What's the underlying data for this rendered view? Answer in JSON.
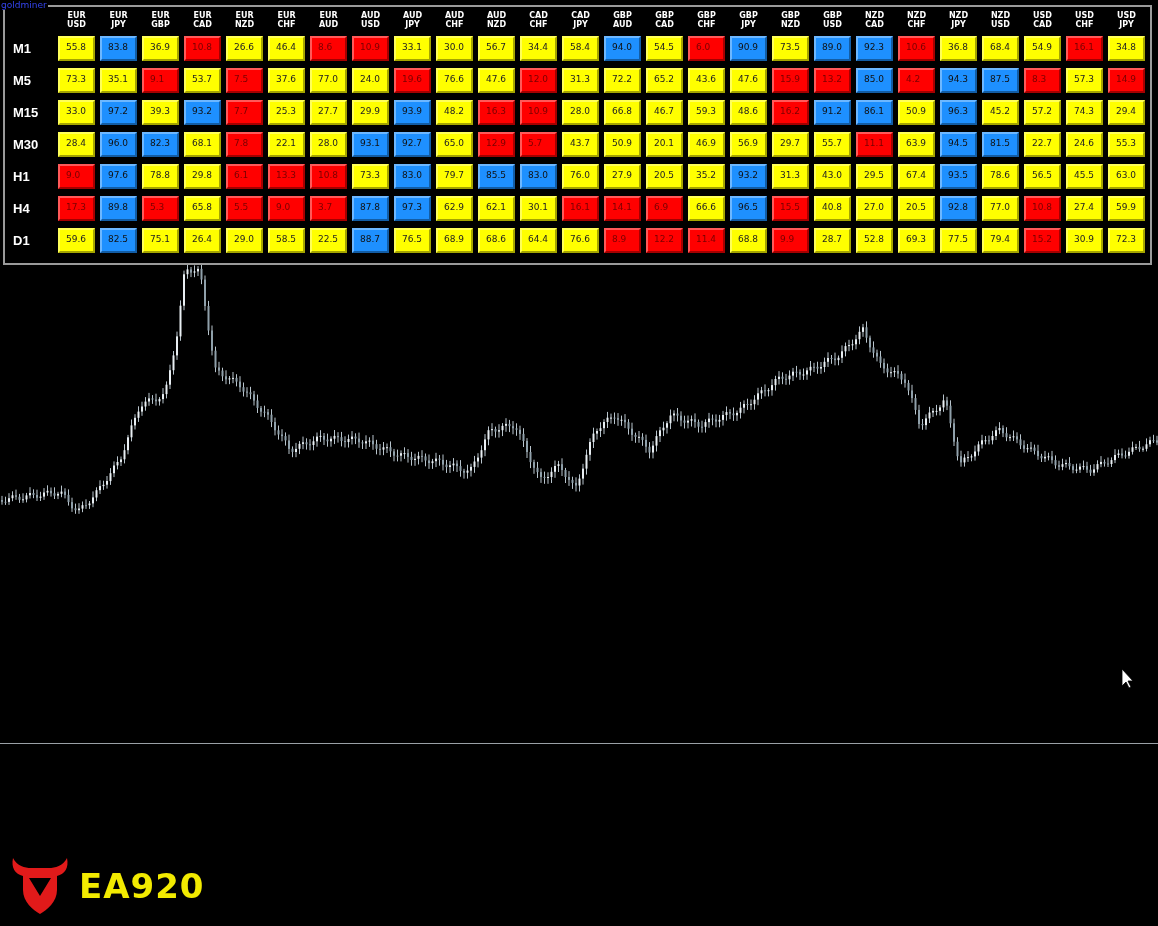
{
  "corner_label": "goldminer",
  "columns": [
    "EUR USD",
    "EUR JPY",
    "EUR GBP",
    "EUR CAD",
    "EUR NZD",
    "EUR CHF",
    "EUR AUD",
    "AUD USD",
    "AUD JPY",
    "AUD CHF",
    "AUD NZD",
    "CAD CHF",
    "CAD JPY",
    "GBP AUD",
    "GBP CAD",
    "GBP CHF",
    "GBP JPY",
    "GBP NZD",
    "GBP USD",
    "NZD CAD",
    "NZD CHF",
    "NZD JPY",
    "NZD USD",
    "USD CAD",
    "USD CHF",
    "USD JPY"
  ],
  "rows": [
    {
      "label": "M1",
      "cells": [
        {
          "value": "55.8",
          "color": "#ffff00"
        },
        {
          "value": "83.8",
          "color": "#1e90ff"
        },
        {
          "value": "36.9",
          "color": "#ffff00"
        },
        {
          "value": "10.8",
          "color": "#ff0000"
        },
        {
          "value": "26.6",
          "color": "#ffff00"
        },
        {
          "value": "46.4",
          "color": "#ffff00"
        },
        {
          "value": "8.6",
          "color": "#ff0000"
        },
        {
          "value": "10.9",
          "color": "#ff0000"
        },
        {
          "value": "33.1",
          "color": "#ffff00"
        },
        {
          "value": "30.0",
          "color": "#ffff00"
        },
        {
          "value": "56.7",
          "color": "#ffff00"
        },
        {
          "value": "34.4",
          "color": "#ffff00"
        },
        {
          "value": "58.4",
          "color": "#ffff00"
        },
        {
          "value": "94.0",
          "color": "#1e90ff"
        },
        {
          "value": "54.5",
          "color": "#ffff00"
        },
        {
          "value": "6.0",
          "color": "#ff0000"
        },
        {
          "value": "90.9",
          "color": "#1e90ff"
        },
        {
          "value": "73.5",
          "color": "#ffff00"
        },
        {
          "value": "89.0",
          "color": "#1e90ff"
        },
        {
          "value": "92.3",
          "color": "#1e90ff"
        },
        {
          "value": "10.6",
          "color": "#ff0000"
        },
        {
          "value": "36.8",
          "color": "#ffff00"
        },
        {
          "value": "68.4",
          "color": "#ffff00"
        },
        {
          "value": "54.9",
          "color": "#ffff00"
        },
        {
          "value": "16.1",
          "color": "#ff0000"
        },
        {
          "value": "34.8",
          "color": "#ffff00"
        }
      ]
    },
    {
      "label": "M5",
      "cells": [
        {
          "value": "73.3",
          "color": "#ffff00"
        },
        {
          "value": "35.1",
          "color": "#ffff00"
        },
        {
          "value": "9.1",
          "color": "#ff0000"
        },
        {
          "value": "53.7",
          "color": "#ffff00"
        },
        {
          "value": "7.5",
          "color": "#ff0000"
        },
        {
          "value": "37.6",
          "color": "#ffff00"
        },
        {
          "value": "77.0",
          "color": "#ffff00"
        },
        {
          "value": "24.0",
          "color": "#ffff00"
        },
        {
          "value": "19.6",
          "color": "#ff0000"
        },
        {
          "value": "76.6",
          "color": "#ffff00"
        },
        {
          "value": "47.6",
          "color": "#ffff00"
        },
        {
          "value": "12.0",
          "color": "#ff0000"
        },
        {
          "value": "31.3",
          "color": "#ffff00"
        },
        {
          "value": "72.2",
          "color": "#ffff00"
        },
        {
          "value": "65.2",
          "color": "#ffff00"
        },
        {
          "value": "43.6",
          "color": "#ffff00"
        },
        {
          "value": "47.6",
          "color": "#ffff00"
        },
        {
          "value": "15.9",
          "color": "#ff0000"
        },
        {
          "value": "13.2",
          "color": "#ff0000"
        },
        {
          "value": "85.0",
          "color": "#1e90ff"
        },
        {
          "value": "4.2",
          "color": "#ff0000"
        },
        {
          "value": "94.3",
          "color": "#1e90ff"
        },
        {
          "value": "87.5",
          "color": "#1e90ff"
        },
        {
          "value": "8.3",
          "color": "#ff0000"
        },
        {
          "value": "57.3",
          "color": "#ffff00"
        },
        {
          "value": "14.9",
          "color": "#ff0000"
        }
      ]
    },
    {
      "label": "M15",
      "cells": [
        {
          "value": "33.0",
          "color": "#ffff00"
        },
        {
          "value": "97.2",
          "color": "#1e90ff"
        },
        {
          "value": "39.3",
          "color": "#ffff00"
        },
        {
          "value": "93.2",
          "color": "#1e90ff"
        },
        {
          "value": "7.7",
          "color": "#ff0000"
        },
        {
          "value": "25.3",
          "color": "#ffff00"
        },
        {
          "value": "27.7",
          "color": "#ffff00"
        },
        {
          "value": "29.9",
          "color": "#ffff00"
        },
        {
          "value": "93.9",
          "color": "#1e90ff"
        },
        {
          "value": "48.2",
          "color": "#ffff00"
        },
        {
          "value": "16.3",
          "color": "#ff0000"
        },
        {
          "value": "10.9",
          "color": "#ff0000"
        },
        {
          "value": "28.0",
          "color": "#ffff00"
        },
        {
          "value": "66.8",
          "color": "#ffff00"
        },
        {
          "value": "46.7",
          "color": "#ffff00"
        },
        {
          "value": "59.3",
          "color": "#ffff00"
        },
        {
          "value": "48.6",
          "color": "#ffff00"
        },
        {
          "value": "16.2",
          "color": "#ff0000"
        },
        {
          "value": "91.2",
          "color": "#1e90ff"
        },
        {
          "value": "86.1",
          "color": "#1e90ff"
        },
        {
          "value": "50.9",
          "color": "#ffff00"
        },
        {
          "value": "96.3",
          "color": "#1e90ff"
        },
        {
          "value": "45.2",
          "color": "#ffff00"
        },
        {
          "value": "57.2",
          "color": "#ffff00"
        },
        {
          "value": "74.3",
          "color": "#ffff00"
        },
        {
          "value": "29.4",
          "color": "#ffff00"
        }
      ]
    },
    {
      "label": "M30",
      "cells": [
        {
          "value": "28.4",
          "color": "#ffff00"
        },
        {
          "value": "96.0",
          "color": "#1e90ff"
        },
        {
          "value": "82.3",
          "color": "#1e90ff"
        },
        {
          "value": "68.1",
          "color": "#ffff00"
        },
        {
          "value": "7.8",
          "color": "#ff0000"
        },
        {
          "value": "22.1",
          "color": "#ffff00"
        },
        {
          "value": "28.0",
          "color": "#ffff00"
        },
        {
          "value": "93.1",
          "color": "#1e90ff"
        },
        {
          "value": "92.7",
          "color": "#1e90ff"
        },
        {
          "value": "65.0",
          "color": "#ffff00"
        },
        {
          "value": "12.9",
          "color": "#ff0000"
        },
        {
          "value": "5.7",
          "color": "#ff0000"
        },
        {
          "value": "43.7",
          "color": "#ffff00"
        },
        {
          "value": "50.9",
          "color": "#ffff00"
        },
        {
          "value": "20.1",
          "color": "#ffff00"
        },
        {
          "value": "46.9",
          "color": "#ffff00"
        },
        {
          "value": "56.9",
          "color": "#ffff00"
        },
        {
          "value": "29.7",
          "color": "#ffff00"
        },
        {
          "value": "55.7",
          "color": "#ffff00"
        },
        {
          "value": "11.1",
          "color": "#ff0000"
        },
        {
          "value": "63.9",
          "color": "#ffff00"
        },
        {
          "value": "94.5",
          "color": "#1e90ff"
        },
        {
          "value": "81.5",
          "color": "#1e90ff"
        },
        {
          "value": "22.7",
          "color": "#ffff00"
        },
        {
          "value": "24.6",
          "color": "#ffff00"
        },
        {
          "value": "55.3",
          "color": "#ffff00"
        }
      ]
    },
    {
      "label": "H1",
      "cells": [
        {
          "value": "9.0",
          "color": "#ff0000"
        },
        {
          "value": "97.6",
          "color": "#1e90ff"
        },
        {
          "value": "78.8",
          "color": "#ffff00"
        },
        {
          "value": "29.8",
          "color": "#ffff00"
        },
        {
          "value": "6.1",
          "color": "#ff0000"
        },
        {
          "value": "13.3",
          "color": "#ff0000"
        },
        {
          "value": "10.8",
          "color": "#ff0000"
        },
        {
          "value": "73.3",
          "color": "#ffff00"
        },
        {
          "value": "83.0",
          "color": "#1e90ff"
        },
        {
          "value": "79.7",
          "color": "#ffff00"
        },
        {
          "value": "85.5",
          "color": "#1e90ff"
        },
        {
          "value": "83.0",
          "color": "#1e90ff"
        },
        {
          "value": "76.0",
          "color": "#ffff00"
        },
        {
          "value": "27.9",
          "color": "#ffff00"
        },
        {
          "value": "20.5",
          "color": "#ffff00"
        },
        {
          "value": "35.2",
          "color": "#ffff00"
        },
        {
          "value": "93.2",
          "color": "#1e90ff"
        },
        {
          "value": "31.3",
          "color": "#ffff00"
        },
        {
          "value": "43.0",
          "color": "#ffff00"
        },
        {
          "value": "29.5",
          "color": "#ffff00"
        },
        {
          "value": "67.4",
          "color": "#ffff00"
        },
        {
          "value": "93.5",
          "color": "#1e90ff"
        },
        {
          "value": "78.6",
          "color": "#ffff00"
        },
        {
          "value": "56.5",
          "color": "#ffff00"
        },
        {
          "value": "45.5",
          "color": "#ffff00"
        },
        {
          "value": "63.0",
          "color": "#ffff00"
        }
      ]
    },
    {
      "label": "H4",
      "cells": [
        {
          "value": "17.3",
          "color": "#ff0000"
        },
        {
          "value": "89.8",
          "color": "#1e90ff"
        },
        {
          "value": "5.3",
          "color": "#ff0000"
        },
        {
          "value": "65.8",
          "color": "#ffff00"
        },
        {
          "value": "5.5",
          "color": "#ff0000"
        },
        {
          "value": "9.0",
          "color": "#ff0000"
        },
        {
          "value": "3.7",
          "color": "#ff0000"
        },
        {
          "value": "87.8",
          "color": "#1e90ff"
        },
        {
          "value": "97.3",
          "color": "#1e90ff"
        },
        {
          "value": "62.9",
          "color": "#ffff00"
        },
        {
          "value": "62.1",
          "color": "#ffff00"
        },
        {
          "value": "30.1",
          "color": "#ffff00"
        },
        {
          "value": "16.1",
          "color": "#ff0000"
        },
        {
          "value": "14.1",
          "color": "#ff0000"
        },
        {
          "value": "6.9",
          "color": "#ff0000"
        },
        {
          "value": "66.6",
          "color": "#ffff00"
        },
        {
          "value": "96.5",
          "color": "#1e90ff"
        },
        {
          "value": "15.5",
          "color": "#ff0000"
        },
        {
          "value": "40.8",
          "color": "#ffff00"
        },
        {
          "value": "27.0",
          "color": "#ffff00"
        },
        {
          "value": "20.5",
          "color": "#ffff00"
        },
        {
          "value": "92.8",
          "color": "#1e90ff"
        },
        {
          "value": "77.0",
          "color": "#ffff00"
        },
        {
          "value": "10.8",
          "color": "#ff0000"
        },
        {
          "value": "27.4",
          "color": "#ffff00"
        },
        {
          "value": "59.9",
          "color": "#ffff00"
        }
      ]
    },
    {
      "label": "D1",
      "cells": [
        {
          "value": "59.6",
          "color": "#ffff00"
        },
        {
          "value": "82.5",
          "color": "#1e90ff"
        },
        {
          "value": "75.1",
          "color": "#ffff00"
        },
        {
          "value": "26.4",
          "color": "#ffff00"
        },
        {
          "value": "29.0",
          "color": "#ffff00"
        },
        {
          "value": "58.5",
          "color": "#ffff00"
        },
        {
          "value": "22.5",
          "color": "#ffff00"
        },
        {
          "value": "88.7",
          "color": "#1e90ff"
        },
        {
          "value": "76.5",
          "color": "#ffff00"
        },
        {
          "value": "68.9",
          "color": "#ffff00"
        },
        {
          "value": "68.6",
          "color": "#ffff00"
        },
        {
          "value": "64.4",
          "color": "#ffff00"
        },
        {
          "value": "76.6",
          "color": "#ffff00"
        },
        {
          "value": "8.9",
          "color": "#ff0000"
        },
        {
          "value": "12.2",
          "color": "#ff0000"
        },
        {
          "value": "11.4",
          "color": "#ff0000"
        },
        {
          "value": "68.8",
          "color": "#ffff00"
        },
        {
          "value": "9.9",
          "color": "#ff0000"
        },
        {
          "value": "28.7",
          "color": "#ffff00"
        },
        {
          "value": "52.8",
          "color": "#ffff00"
        },
        {
          "value": "69.3",
          "color": "#ffff00"
        },
        {
          "value": "77.5",
          "color": "#ffff00"
        },
        {
          "value": "79.4",
          "color": "#ffff00"
        },
        {
          "value": "15.2",
          "color": "#ff0000"
        },
        {
          "value": "30.9",
          "color": "#ffff00"
        },
        {
          "value": "72.3",
          "color": "#ffff00"
        }
      ]
    }
  ],
  "logo": {
    "text": "EA920"
  }
}
